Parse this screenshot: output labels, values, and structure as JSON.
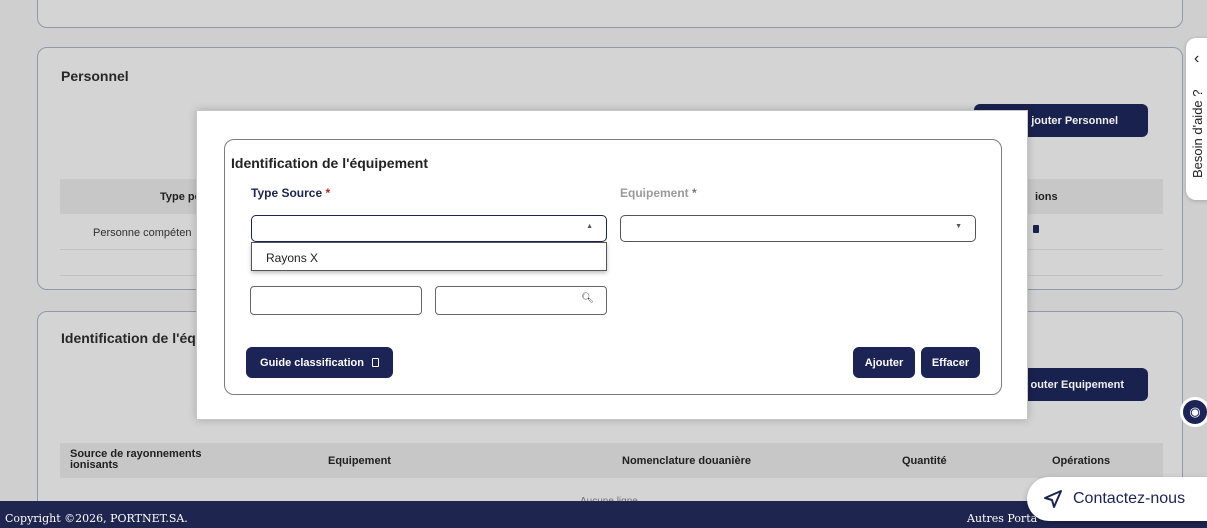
{
  "personnel": {
    "title": "Personnel",
    "add_button": "jouter Personnel",
    "col_type": "Type pe",
    "col_ops": "ions",
    "row_value": "Personne compéten"
  },
  "equipment_section": {
    "title": "Identification de l'équ",
    "add_button": "outer Equipement",
    "columns": [
      "Source de rayonnements ionisants",
      "Equipement",
      "Nomenclature douanière",
      "Quantité",
      "Opérations"
    ],
    "empty": "Aucune ligne"
  },
  "modal": {
    "title": "Identification de l'équipement",
    "type_source_label": "Type Source",
    "equipement_label": "Equipement",
    "required_mark": "*",
    "dropdown_option": "Rayons X",
    "guide_button": "Guide classification",
    "ajouter_button": "Ajouter",
    "effacer_button": "Effacer"
  },
  "help_tab": {
    "label": "Besoin d'aide ?"
  },
  "contact": {
    "label": "Contactez-nous"
  },
  "footer": {
    "copyright": "Copyright ©2026, PORTNET.SA.",
    "others": "Autres Porta"
  },
  "colors": {
    "primary": "#1b2454",
    "required": "#c42020"
  }
}
